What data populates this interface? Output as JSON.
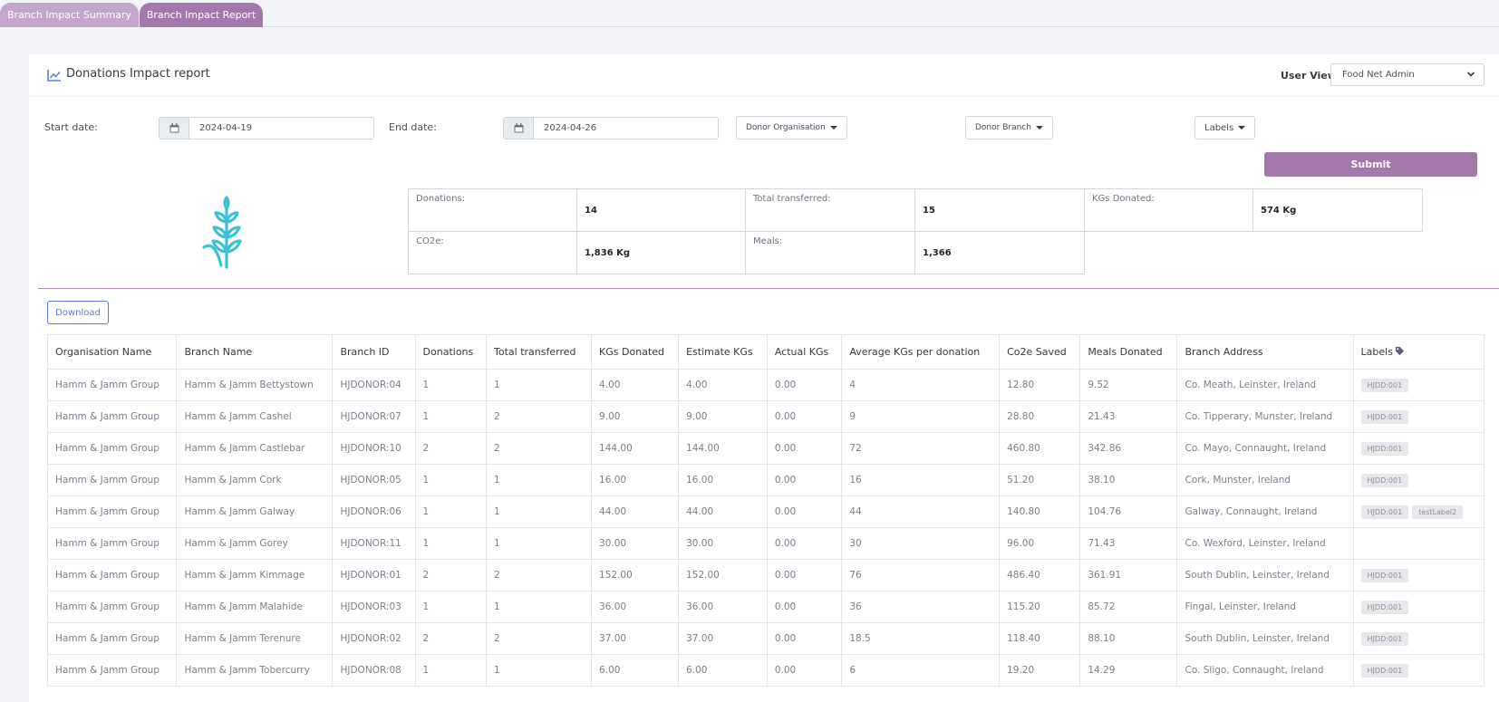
{
  "tabs": [
    "Branch Impact Summary",
    "Branch Impact Report"
  ],
  "header": {
    "title": "Donations Impact report",
    "user_view_label": "User View:",
    "user_view_value": "Food Net Admin"
  },
  "filters": {
    "start_label": "Start date:",
    "start_value": "2024-04-19",
    "end_label": "End date:",
    "end_value": "2024-04-26",
    "donor_org": "Donor Organisation",
    "donor_branch": "Donor Branch",
    "labels": "Labels",
    "submit": "Submit"
  },
  "stats": {
    "donations_label": "Donations:",
    "donations_value": "14",
    "transferred_label": "Total transferred:",
    "transferred_value": "15",
    "kgs_label": "KGs Donated:",
    "kgs_value": "574 Kg",
    "co2_label": "CO2e:",
    "co2_value": "1,836 Kg",
    "meals_label": "Meals:",
    "meals_value": "1,366"
  },
  "download": "Download",
  "table": {
    "columns": [
      "Organisation Name",
      "Branch Name",
      "Branch ID",
      "Donations",
      "Total transferred",
      "KGs Donated",
      "Estimate KGs",
      "Actual KGs",
      "Average KGs per donation",
      "Co2e Saved",
      "Meals Donated",
      "Branch Address",
      "Labels"
    ],
    "rows": [
      [
        "Hamm & Jamm Group",
        "Hamm & Jamm Bettystown",
        "HJDONOR:04",
        "1",
        "1",
        "4.00",
        "4.00",
        "0.00",
        "4",
        "12.80",
        "9.52",
        "Co. Meath, Leinster, Ireland",
        [
          "HJDD:001"
        ]
      ],
      [
        "Hamm & Jamm Group",
        "Hamm & Jamm Cashel",
        "HJDONOR:07",
        "1",
        "2",
        "9.00",
        "9.00",
        "0.00",
        "9",
        "28.80",
        "21.43",
        "Co. Tipperary, Munster, Ireland",
        [
          "HJDD:001"
        ]
      ],
      [
        "Hamm & Jamm Group",
        "Hamm & Jamm Castlebar",
        "HJDONOR:10",
        "2",
        "2",
        "144.00",
        "144.00",
        "0.00",
        "72",
        "460.80",
        "342.86",
        "Co. Mayo, Connaught, Ireland",
        [
          "HJDD:001"
        ]
      ],
      [
        "Hamm & Jamm Group",
        "Hamm & Jamm Cork",
        "HJDONOR:05",
        "1",
        "1",
        "16.00",
        "16.00",
        "0.00",
        "16",
        "51.20",
        "38.10",
        "Cork, Munster, Ireland",
        [
          "HJDD:001"
        ]
      ],
      [
        "Hamm & Jamm Group",
        "Hamm & Jamm Galway",
        "HJDONOR:06",
        "1",
        "1",
        "44.00",
        "44.00",
        "0.00",
        "44",
        "140.80",
        "104.76",
        "Galway, Connaught, Ireland",
        [
          "HJDD:001",
          "testLabel2"
        ]
      ],
      [
        "Hamm & Jamm Group",
        "Hamm & Jamm Gorey",
        "HJDONOR:11",
        "1",
        "1",
        "30.00",
        "30.00",
        "0.00",
        "30",
        "96.00",
        "71.43",
        "Co. Wexford, Leinster, Ireland",
        []
      ],
      [
        "Hamm & Jamm Group",
        "Hamm & Jamm Kimmage",
        "HJDONOR:01",
        "2",
        "2",
        "152.00",
        "152.00",
        "0.00",
        "76",
        "486.40",
        "361.91",
        "South Dublin, Leinster, Ireland",
        [
          "HJDD:001"
        ]
      ],
      [
        "Hamm & Jamm Group",
        "Hamm & Jamm Malahide",
        "HJDONOR:03",
        "1",
        "1",
        "36.00",
        "36.00",
        "0.00",
        "36",
        "115.20",
        "85.72",
        "Fingal, Leinster, Ireland",
        [
          "HJDD:001"
        ]
      ],
      [
        "Hamm & Jamm Group",
        "Hamm & Jamm Terenure",
        "HJDONOR:02",
        "2",
        "2",
        "37.00",
        "37.00",
        "0.00",
        "18.5",
        "118.40",
        "88.10",
        "South Dublin, Leinster, Ireland",
        [
          "HJDD:001"
        ]
      ],
      [
        "Hamm & Jamm Group",
        "Hamm & Jamm Tobercurry",
        "HJDONOR:08",
        "1",
        "1",
        "6.00",
        "6.00",
        "0.00",
        "6",
        "19.20",
        "14.29",
        "Co. Sligo, Connaught, Ireland",
        [
          "HJDD:001"
        ]
      ]
    ]
  },
  "colors": {
    "accent": "#a477ad",
    "accent_light": "#c4a6ca",
    "link_blue": "#5f78e8",
    "wheat": "#3ec1d3"
  },
  "icons": [
    "chart-line-icon",
    "chevron-down-icon",
    "calendar-icon",
    "wheat-icon",
    "tag-icon"
  ]
}
